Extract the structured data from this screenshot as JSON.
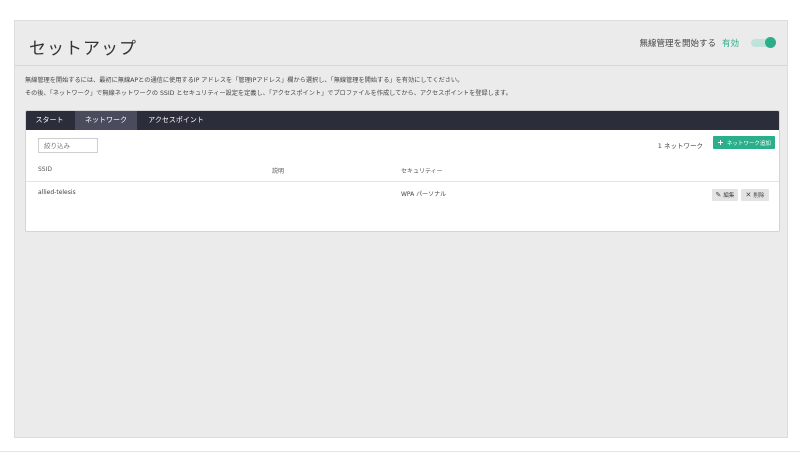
{
  "header": {
    "title": "セットアップ",
    "wireless_label": "無線管理を開始する",
    "wireless_state": "有効",
    "wireless_enabled": true
  },
  "intro": {
    "line1": "無線管理を開始するには、最初に無線APとの通信に使用するIP アドレスを「管理IPアドレス」欄から選択し、「無線管理を開始する」を有効にしてください。",
    "line2": "その後、「ネットワーク」で無線ネットワークの SSID とセキュリティー設定を定義し、「アクセスポイント」でプロファイルを作成してから、アクセスポイントを登録します。"
  },
  "tabs": [
    {
      "label": "スタート",
      "active": false
    },
    {
      "label": "ネットワーク",
      "active": true
    },
    {
      "label": "アクセスポイント",
      "active": false
    }
  ],
  "toolbar": {
    "filter_placeholder": "絞り込み",
    "count_text": "1 ネットワーク",
    "add_button_label": "ネットワーク追加",
    "add_icon": "plus-icon"
  },
  "table": {
    "headers": [
      "SSID",
      "説明",
      "セキュリティー"
    ],
    "rows": [
      {
        "ssid": "allied-telesis",
        "description": "",
        "security": "WPA パーソナル",
        "edit_label": "編集",
        "delete_label": "削除"
      }
    ]
  },
  "colors": {
    "accent": "#2bae8a",
    "tabbar": "#2b2d3a",
    "tab_active": "#4a4c5e"
  }
}
